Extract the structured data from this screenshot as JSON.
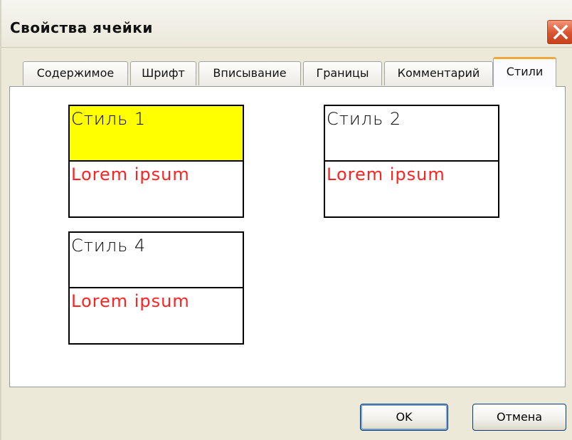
{
  "window": {
    "title": "Свойства ячейки"
  },
  "tabs": [
    {
      "label": "Содержимое",
      "active": false
    },
    {
      "label": "Шрифт",
      "active": false
    },
    {
      "label": "Вписывание",
      "active": false
    },
    {
      "label": "Границы",
      "active": false
    },
    {
      "label": "Комментарий",
      "active": false
    },
    {
      "label": "Стили",
      "active": true
    }
  ],
  "styles": [
    {
      "name": "Стиль 1",
      "sample": "Lorem ipsum",
      "fill": "#ffff00",
      "sample_color": "#ff2222"
    },
    {
      "name": "Стиль 2",
      "sample": "Lorem ipsum",
      "fill": "#ffffff",
      "sample_color": "#ff2222"
    },
    {
      "name": "Стиль 4",
      "sample": "Lorem ipsum",
      "fill": "#ffffff",
      "sample_color": "#ff2222"
    }
  ],
  "buttons": {
    "ok_label": "OK",
    "cancel_label": "Отмена"
  },
  "icons": {
    "close": "close-icon"
  },
  "colors": {
    "active_tab_accent": "#f1a83a",
    "close_button": "#d9532f",
    "dialog_face": "#ece9d8"
  }
}
